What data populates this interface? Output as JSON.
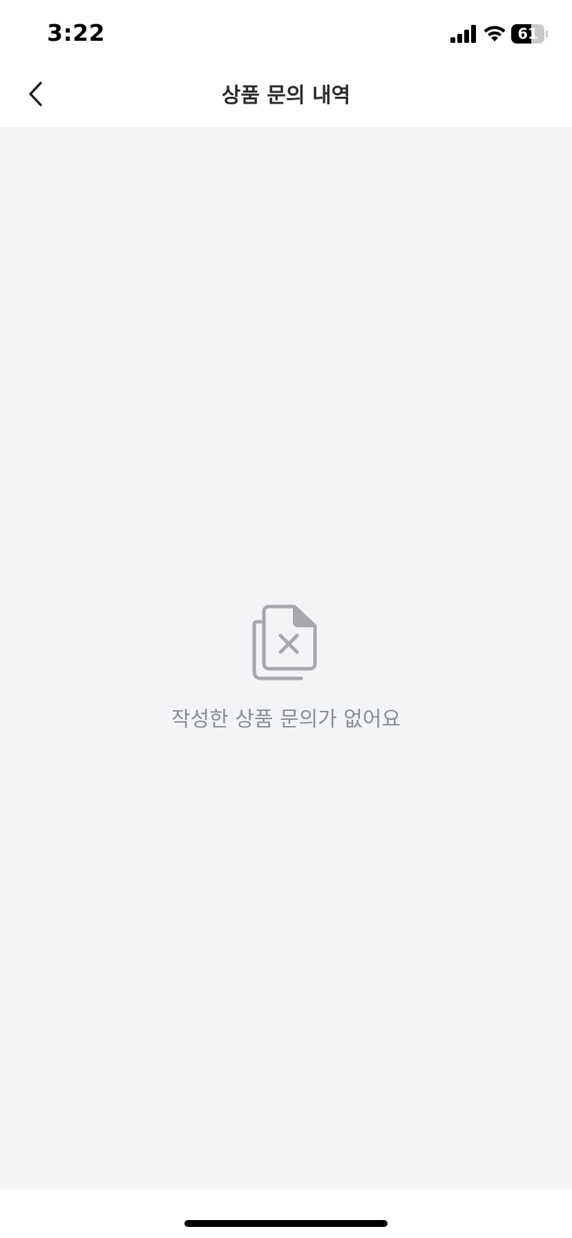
{
  "status_bar": {
    "time": "3:22",
    "battery_level": "61",
    "battery_fraction": 0.61
  },
  "header": {
    "back_icon": "chevron-left-icon",
    "title": "상품 문의 내역"
  },
  "empty_state": {
    "icon": "document-x-icon",
    "message": "작성한 상품 문의가 없어요"
  },
  "colors": {
    "content_background": "#f3f4f6",
    "empty_text": "#8a8d92",
    "icon_gray": "#a6a8ab",
    "title_text": "#2a2a2a"
  }
}
